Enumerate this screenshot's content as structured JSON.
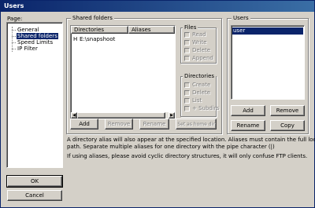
{
  "window": {
    "title": "Users"
  },
  "pages": {
    "label": "Page:",
    "items": [
      {
        "label": "General",
        "selected": false
      },
      {
        "label": "Shared folders",
        "selected": true
      },
      {
        "label": "Speed Limits",
        "selected": false
      },
      {
        "label": "IP Filter",
        "selected": false
      }
    ]
  },
  "shared_folders": {
    "title": "Shared folders",
    "columns": [
      "Directories",
      "Aliases"
    ],
    "rows": [
      {
        "flag": "H",
        "directory": "E:\\snapshoot",
        "alias": ""
      }
    ],
    "buttons": {
      "add": "Add",
      "remove": "Remove",
      "rename": "Rename",
      "set_home": "Set as home dir"
    }
  },
  "files": {
    "title": "Files",
    "options": [
      "Read",
      "Write",
      "Delete",
      "Append"
    ]
  },
  "directories": {
    "title": "Directories",
    "options": [
      "Create",
      "Delete",
      "List",
      "+ Subdirs"
    ]
  },
  "users": {
    "title": "Users",
    "items": [
      {
        "label": "user",
        "selected": true
      }
    ],
    "buttons": {
      "add": "Add",
      "remove": "Remove",
      "rename": "Rename",
      "copy": "Copy"
    }
  },
  "info": {
    "line1": "A directory alias will also appear at the specified location. Aliases must contain the full local",
    "line2": "path. Separate multiple aliases for one directory with the pipe character (|)",
    "line3": "If using aliases, please avoid cyclic directory structures, it will only confuse FTP clients."
  },
  "dialog_buttons": {
    "ok": "OK",
    "cancel": "Cancel"
  }
}
